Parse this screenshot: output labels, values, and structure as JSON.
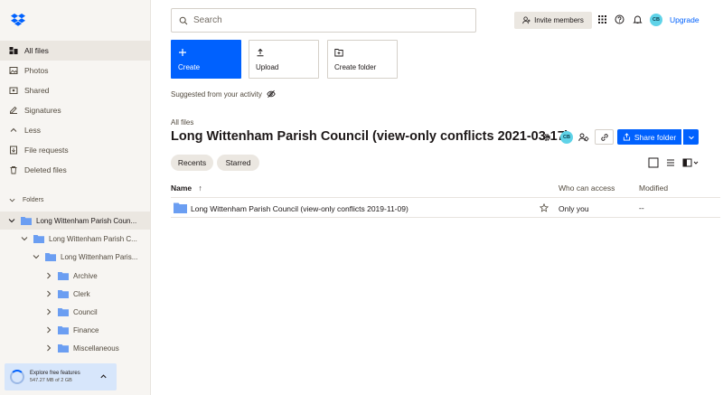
{
  "sidebar": {
    "nav": [
      {
        "label": "All files",
        "icon": "all-files-icon",
        "active": true
      },
      {
        "label": "Photos",
        "icon": "photos-icon"
      },
      {
        "label": "Shared",
        "icon": "shared-icon"
      },
      {
        "label": "Signatures",
        "icon": "signatures-icon"
      },
      {
        "label": "Less",
        "icon": "chevron-up-icon"
      },
      {
        "label": "File requests",
        "icon": "file-requests-icon"
      },
      {
        "label": "Deleted files",
        "icon": "trash-icon"
      }
    ],
    "folders_heading": "Folders",
    "tree": [
      {
        "label": "Long Wittenham Parish Coun...",
        "active": true
      },
      {
        "label": "Long Wittenham Parish C..."
      },
      {
        "label": "Long Wittenham Paris..."
      },
      {
        "label": "Archive"
      },
      {
        "label": "Clerk"
      },
      {
        "label": "Council"
      },
      {
        "label": "Finance"
      },
      {
        "label": "Miscellaneous"
      }
    ],
    "explore": {
      "title": "Explore free features",
      "usage": "547.27 MB of 2 GB"
    }
  },
  "topbar": {
    "search_placeholder": "Search",
    "invite_label": "Invite members",
    "avatar_initials": "CB",
    "upgrade_label": "Upgrade"
  },
  "actions": {
    "create": "Create",
    "upload": "Upload",
    "create_folder": "Create folder"
  },
  "suggested_label": "Suggested from your activity",
  "breadcrumb": "All files",
  "page_title": "Long Wittenham Parish Council (view-only conflicts 2021-03-17)",
  "share_button": "Share folder",
  "filters": {
    "recents": "Recents",
    "starred": "Starred"
  },
  "table": {
    "columns": {
      "name": "Name",
      "sort_arrow": "↑",
      "access": "Who can access",
      "modified": "Modified"
    },
    "rows": [
      {
        "name": "Long Wittenham Parish Council (view-only conflicts 2019-11-09)",
        "access": "Only you",
        "modified": "--"
      }
    ]
  },
  "colors": {
    "accent": "#0061fe",
    "sidebar_bg": "#f7f5f2",
    "folder": "#6b9ef2",
    "avatar": "#5fd3e8"
  }
}
